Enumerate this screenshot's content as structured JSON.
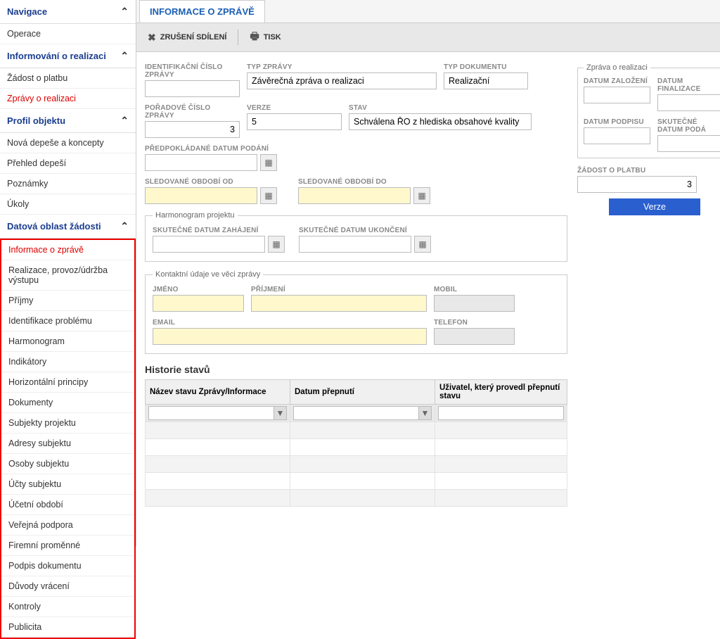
{
  "sidebar": {
    "nav_header": "Navigace",
    "operace": "Operace",
    "inform_header": "Informování o realizaci",
    "zadost_platbu": "Žádost o platbu",
    "zpravy_realizaci": "Zprávy o realizaci",
    "profil_header": "Profil objektu",
    "nova_depese": "Nová depeše a koncepty",
    "prehled_depesi": "Přehled depeší",
    "poznamky": "Poznámky",
    "ukoly": "Úkoly",
    "datova_header": "Datová oblast žádosti",
    "items": [
      "Informace o zprávě",
      "Realizace, provoz/údržba výstupu",
      "Příjmy",
      "Identifikace problému",
      "Harmonogram",
      "Indikátory",
      "Horizontální principy",
      "Dokumenty",
      "Subjekty projektu",
      "Adresy subjektu",
      "Osoby subjektu",
      "Účty subjektu",
      "Účetní období",
      "Veřejná podpora",
      "Firemní proměnné",
      "Podpis dokumentu",
      "Důvody vrácení",
      "Kontroly",
      "Publicita"
    ]
  },
  "tab_title": "INFORMACE O ZPRÁVĚ",
  "toolbar": {
    "cancel_share": "ZRUŠENÍ SDÍLENÍ",
    "print": "TISK"
  },
  "form": {
    "id_zpravy_lbl": "IDENTIFIKAČNÍ ČÍSLO ZPRÁVY",
    "typ_zpravy_lbl": "TYP ZPRÁVY",
    "typ_zpravy_val": "Závěrečná zpráva o realizaci",
    "typ_dok_lbl": "TYP DOKUMENTU",
    "typ_dok_val": "Realizační",
    "poradove_lbl": "POŘADOVÉ ČÍSLO ZPRÁVY",
    "poradove_val": "3",
    "verze_lbl": "VERZE",
    "verze_val": "5",
    "stav_lbl": "STAV",
    "stav_val": "Schválena ŘO z hlediska obsahové kvality",
    "predpokl_lbl": "PŘEDPOKLÁDANÉ DATUM PODÁNÍ",
    "sled_od_lbl": "SLEDOVANÉ OBDOBÍ OD",
    "sled_do_lbl": "SLEDOVANÉ OBDOBÍ DO",
    "harm_legend": "Harmonogram projektu",
    "skut_zah_lbl": "SKUTEČNÉ DATUM ZAHÁJENÍ",
    "skut_uk_lbl": "SKUTEČNÉ DATUM UKONČENÍ",
    "kontakt_legend": "Kontaktní údaje ve věci zprávy",
    "jmeno_lbl": "JMÉNO",
    "prijmeni_lbl": "PŘÍJMENÍ",
    "mobil_lbl": "MOBIL",
    "email_lbl": "EMAIL",
    "telefon_lbl": "TELEFON"
  },
  "right": {
    "zprava_legend": "Zpráva o realizaci",
    "datum_zal_lbl": "DATUM ZALOŽENÍ",
    "datum_fin_lbl": "DATUM FINALIZACE",
    "datum_pod_lbl": "DATUM PODPISU",
    "skut_pod_lbl": "SKUTEČNÉ DATUM PODÁ",
    "zadost_lbl": "ŽÁDOST O PLATBU",
    "zadost_val": "3",
    "verze_btn": "Verze"
  },
  "history": {
    "title": "Historie stavů",
    "col1": "Název stavu Zprávy/Informace",
    "col2": "Datum přepnutí",
    "col3": "Uživatel, který provedl přepnutí stavu"
  }
}
